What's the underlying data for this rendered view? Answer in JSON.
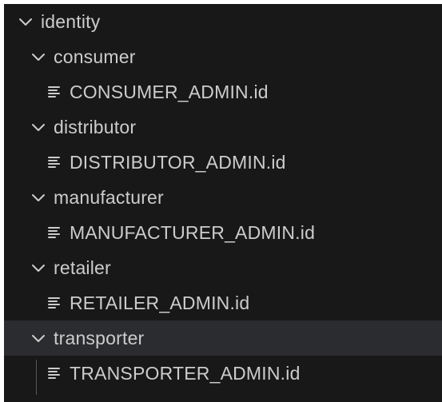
{
  "tree": {
    "root": {
      "label": "identity",
      "icon": "chevron-down-icon"
    },
    "folders": [
      {
        "label": "consumer",
        "icon": "chevron-down-icon",
        "file": {
          "label": "CONSUMER_ADMIN.id",
          "icon": "lines-file-icon"
        }
      },
      {
        "label": "distributor",
        "icon": "chevron-down-icon",
        "file": {
          "label": "DISTRIBUTOR_ADMIN.id",
          "icon": "lines-file-icon"
        }
      },
      {
        "label": "manufacturer",
        "icon": "chevron-down-icon",
        "file": {
          "label": "MANUFACTURER_ADMIN.id",
          "icon": "lines-file-icon"
        }
      },
      {
        "label": "retailer",
        "icon": "chevron-down-icon",
        "file": {
          "label": "RETAILER_ADMIN.id",
          "icon": "lines-file-icon"
        }
      },
      {
        "label": "transporter",
        "icon": "chevron-down-icon",
        "selected": true,
        "file": {
          "label": "TRANSPORTER_ADMIN.id",
          "icon": "lines-file-icon"
        }
      }
    ]
  },
  "colors": {
    "background": "#181818",
    "selected_row": "#2b2c2f",
    "text": "#cccccc",
    "indent_guide": "#585858"
  }
}
